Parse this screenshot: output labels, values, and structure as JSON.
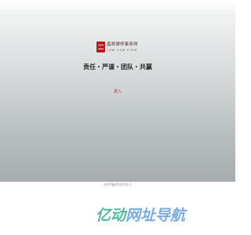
{
  "logo": {
    "seal_icon": "firm-seal-icon",
    "firm_name": "昌凯律师事务所",
    "firm_name_en": "LAW  LAW  FIRM"
  },
  "slogan": "责任・严谨・团队・共赢",
  "enter_link": "进入",
  "footer": {
    "icp": "沪ICP备XXXXX号-1"
  },
  "watermark": {
    "part1": "亿动",
    "part2": "网址导航"
  },
  "colors": {
    "accent_red": "#c4161c",
    "watermark_green": "#1aa37a",
    "watermark_blue": "#4a90d9"
  }
}
